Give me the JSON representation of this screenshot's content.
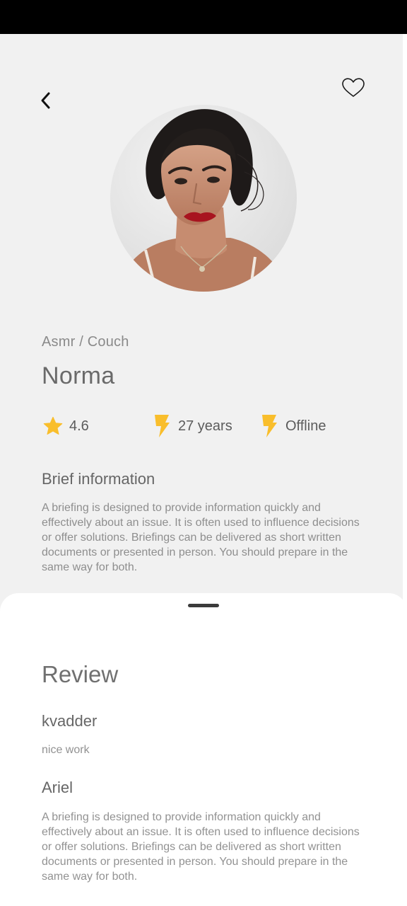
{
  "profile": {
    "category": "Asmr / Couch",
    "name": "Norma",
    "avatar_alt": "profile photo"
  },
  "stats": {
    "rating": "4.6",
    "age": "27 years",
    "status": "Offline"
  },
  "brief": {
    "title": "Brief information",
    "text": "A briefing is designed to provide information quickly and effectively about an issue. It is often used to influence decisions or offer solutions. Briefings can be delivered as short written documents or presented in person. You should prepare in the same way for both."
  },
  "reviews": {
    "title": "Review",
    "items": [
      {
        "author": "kvadder",
        "text": "nice work"
      },
      {
        "author": "Ariel",
        "text": "A briefing is designed to provide information quickly and effectively about an issue. It is often used to influence decisions or offer solutions. Briefings can be delivered as short written documents or presented in person. You should prepare in the same way for both."
      }
    ]
  },
  "icons": {
    "back": "chevron-left-icon",
    "favorite": "heart-outline-icon",
    "rating": "star-icon",
    "age": "bolt-icon",
    "status": "bolt-icon"
  },
  "colors": {
    "accent": "#F9BE2C",
    "background": "#F1F1F1",
    "sheet": "#FFFFFF"
  }
}
